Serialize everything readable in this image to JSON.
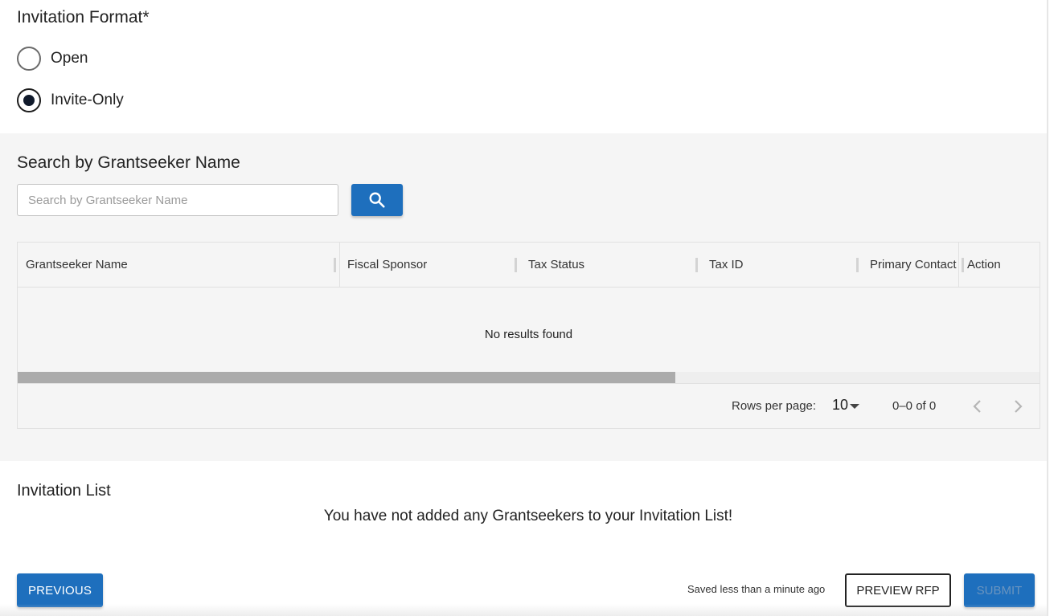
{
  "invitation_format": {
    "label": "Invitation Format*",
    "options": [
      {
        "label": "Open",
        "selected": false
      },
      {
        "label": "Invite-Only",
        "selected": true
      }
    ]
  },
  "search": {
    "title": "Search by Grantseeker Name",
    "placeholder": "Search by Grantseeker Name",
    "value": "",
    "button_icon": "search-icon"
  },
  "table": {
    "columns": [
      "Grantseeker Name",
      "Fiscal Sponsor",
      "Tax Status",
      "Tax ID",
      "Primary Contact",
      "Action"
    ],
    "empty_message": "No results found",
    "footer": {
      "rows_per_page_label": "Rows per page:",
      "rows_per_page_value": "10",
      "range": "0–0 of 0",
      "prev_icon": "chevron-left-icon",
      "next_icon": "chevron-right-icon"
    }
  },
  "invitation_list": {
    "title": "Invitation List",
    "empty_message": "You have not added any Grantseekers to your Invitation List!"
  },
  "actions": {
    "previous_label": "PREVIOUS",
    "saved_status": "Saved less than a minute ago",
    "preview_label": "PREVIEW RFP",
    "submit_label": "SUBMIT",
    "submit_disabled": true
  },
  "colors": {
    "primary": "#1e6fbd",
    "section_gray": "#f5f5f5",
    "scroll_thumb": "#ababab"
  }
}
